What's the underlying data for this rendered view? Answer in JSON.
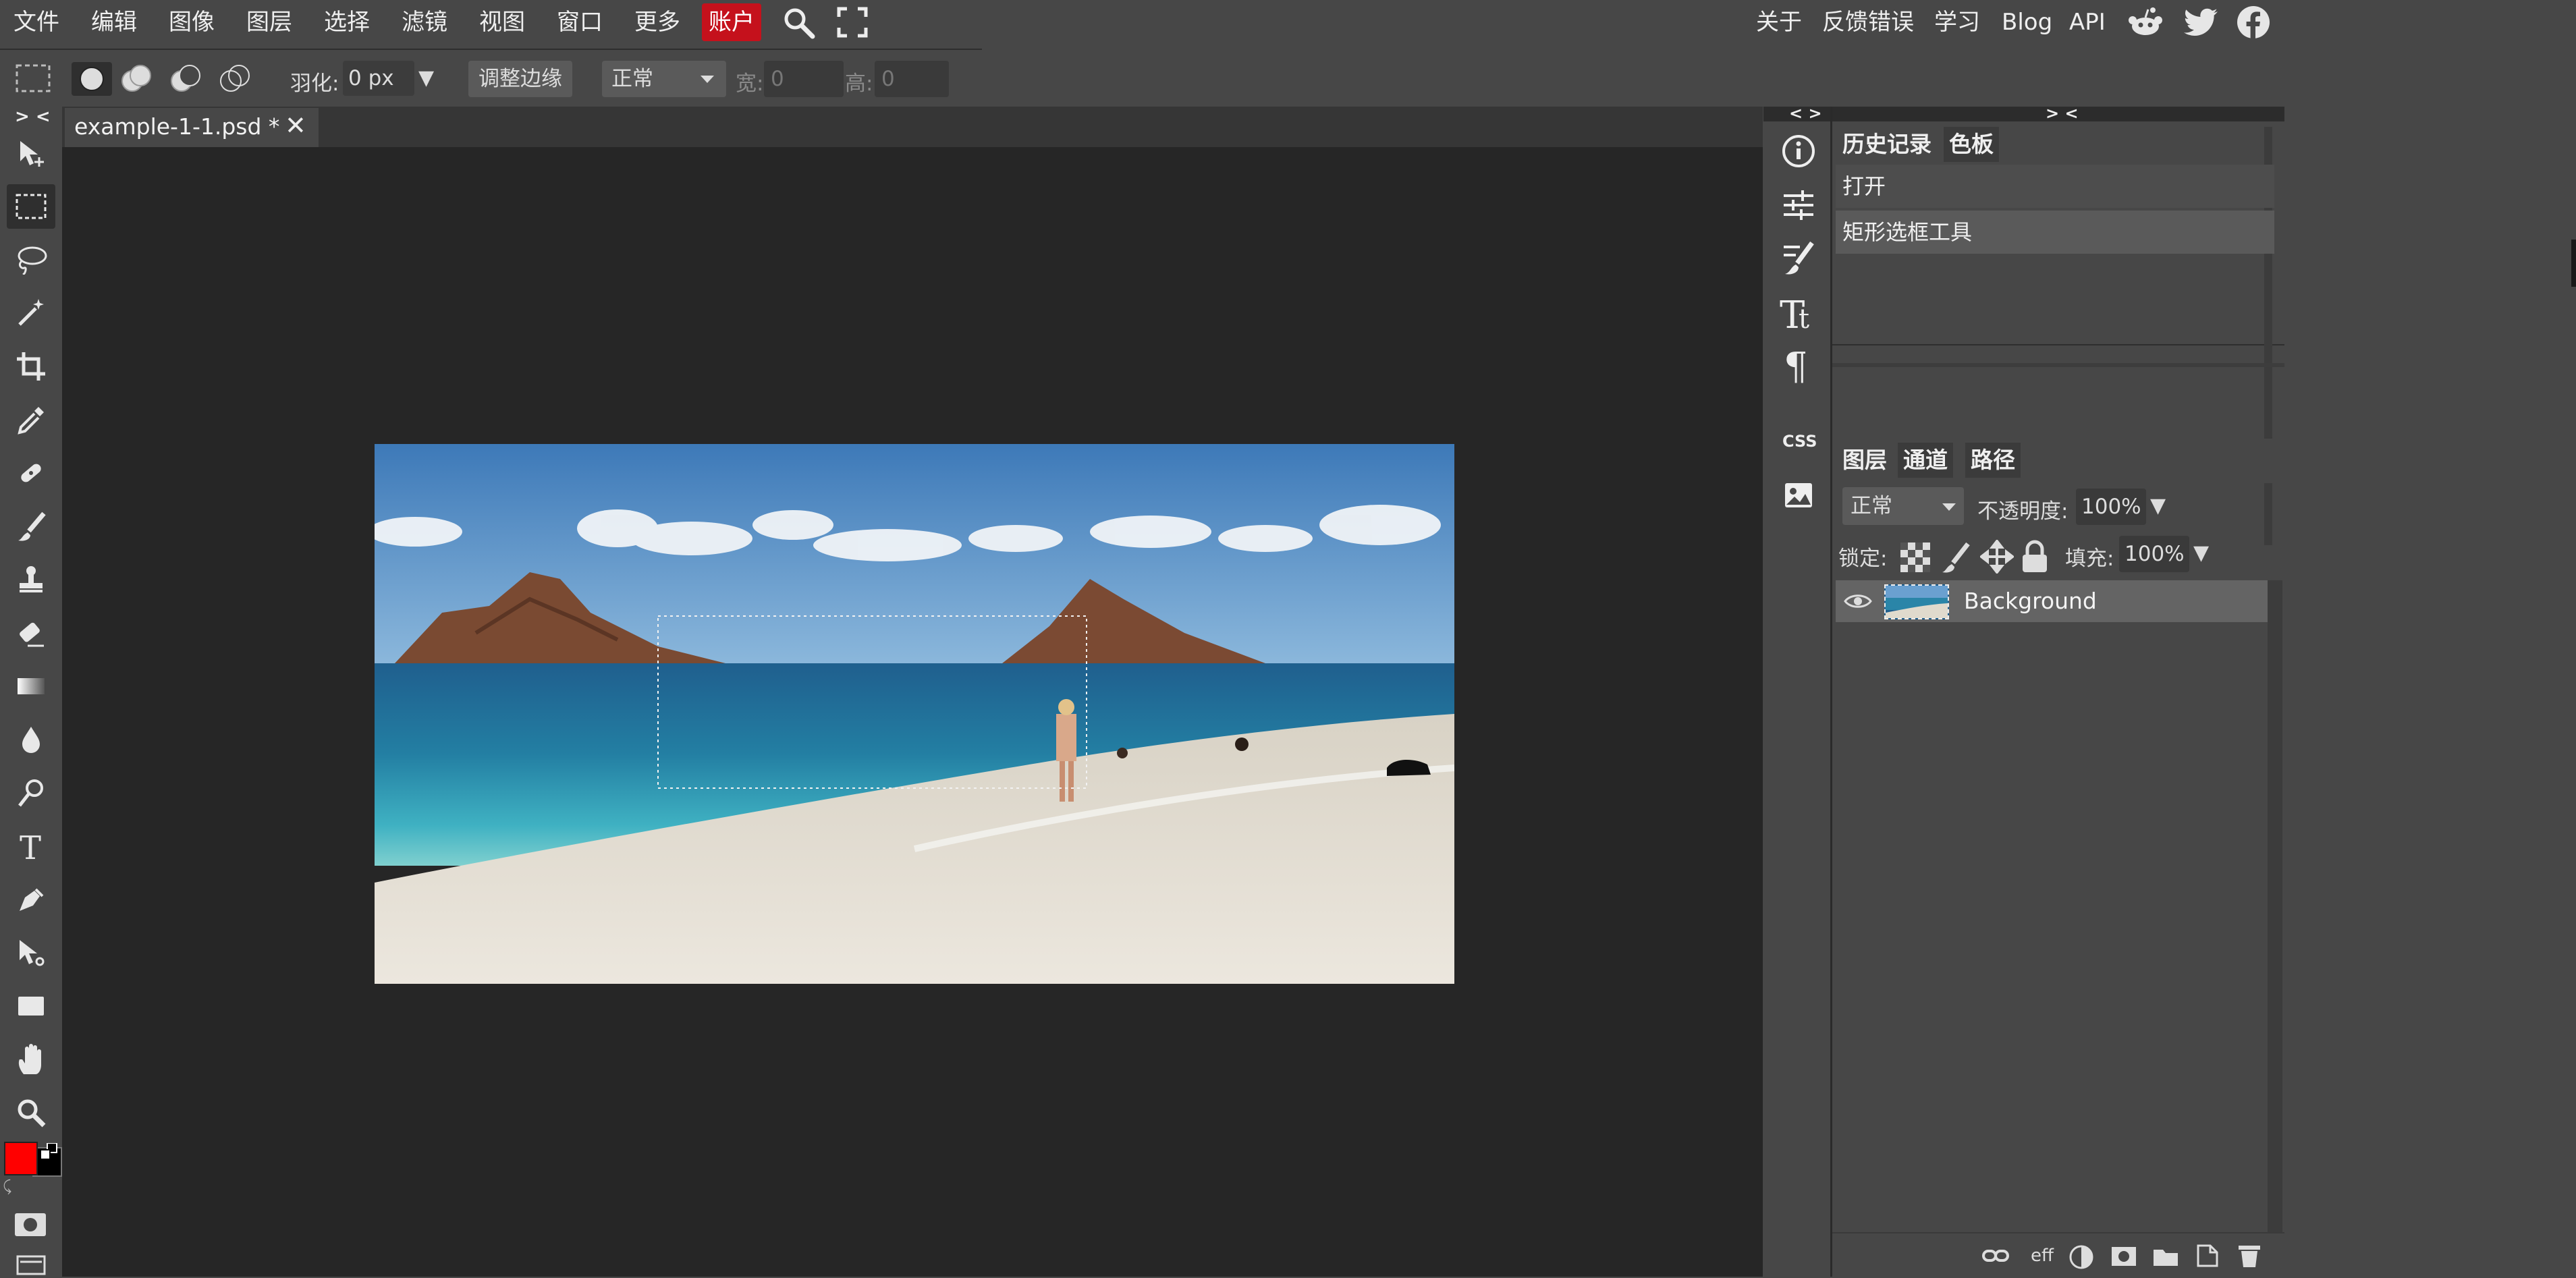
{
  "menu": {
    "items": [
      "文件",
      "编辑",
      "图像",
      "图层",
      "选择",
      "滤镜",
      "视图",
      "窗口",
      "更多"
    ],
    "account": "账户",
    "right": [
      "关于",
      "反馈错误",
      "学习",
      "Blog",
      "API"
    ],
    "accent_color": "#c5111c"
  },
  "options": {
    "feather_label": "羽化:",
    "feather_value": "0 px",
    "refine_edge": "调整边缘",
    "mode_value": "正常",
    "width_label": "宽:",
    "width_value": "0",
    "height_label": "高:",
    "height_value": "0"
  },
  "toolbar": {
    "collapse": "> <",
    "tools": [
      "move-tool",
      "rect-select-tool",
      "lasso-tool",
      "magic-wand-tool",
      "crop-tool",
      "eyedropper-tool",
      "healing-tool",
      "brush-tool",
      "clone-stamp-tool",
      "eraser-tool",
      "gradient-tool",
      "blur-tool",
      "dodge-tool",
      "type-tool",
      "pen-tool",
      "path-select-tool",
      "shape-tool",
      "hand-tool",
      "zoom-tool"
    ],
    "fg_color": "#ff0000",
    "bg_color": "#000000"
  },
  "document": {
    "tab_title": "example-1-1.psd *"
  },
  "dock": {
    "collapse": "< >",
    "css_label": "CSS"
  },
  "history_panel": {
    "collapse": "> <",
    "tabs": [
      "历史记录",
      "色板"
    ],
    "items": [
      "打开",
      "矩形选框工具"
    ]
  },
  "layers_panel": {
    "tabs": [
      "图层",
      "通道",
      "路径"
    ],
    "blend_mode": "正常",
    "opacity_label": "不透明度:",
    "opacity_value": "100%",
    "lock_label": "锁定:",
    "fill_label": "填充:",
    "fill_value": "100%",
    "layers": [
      {
        "name": "Background",
        "visible": true
      }
    ],
    "footer_eff": "eff"
  }
}
